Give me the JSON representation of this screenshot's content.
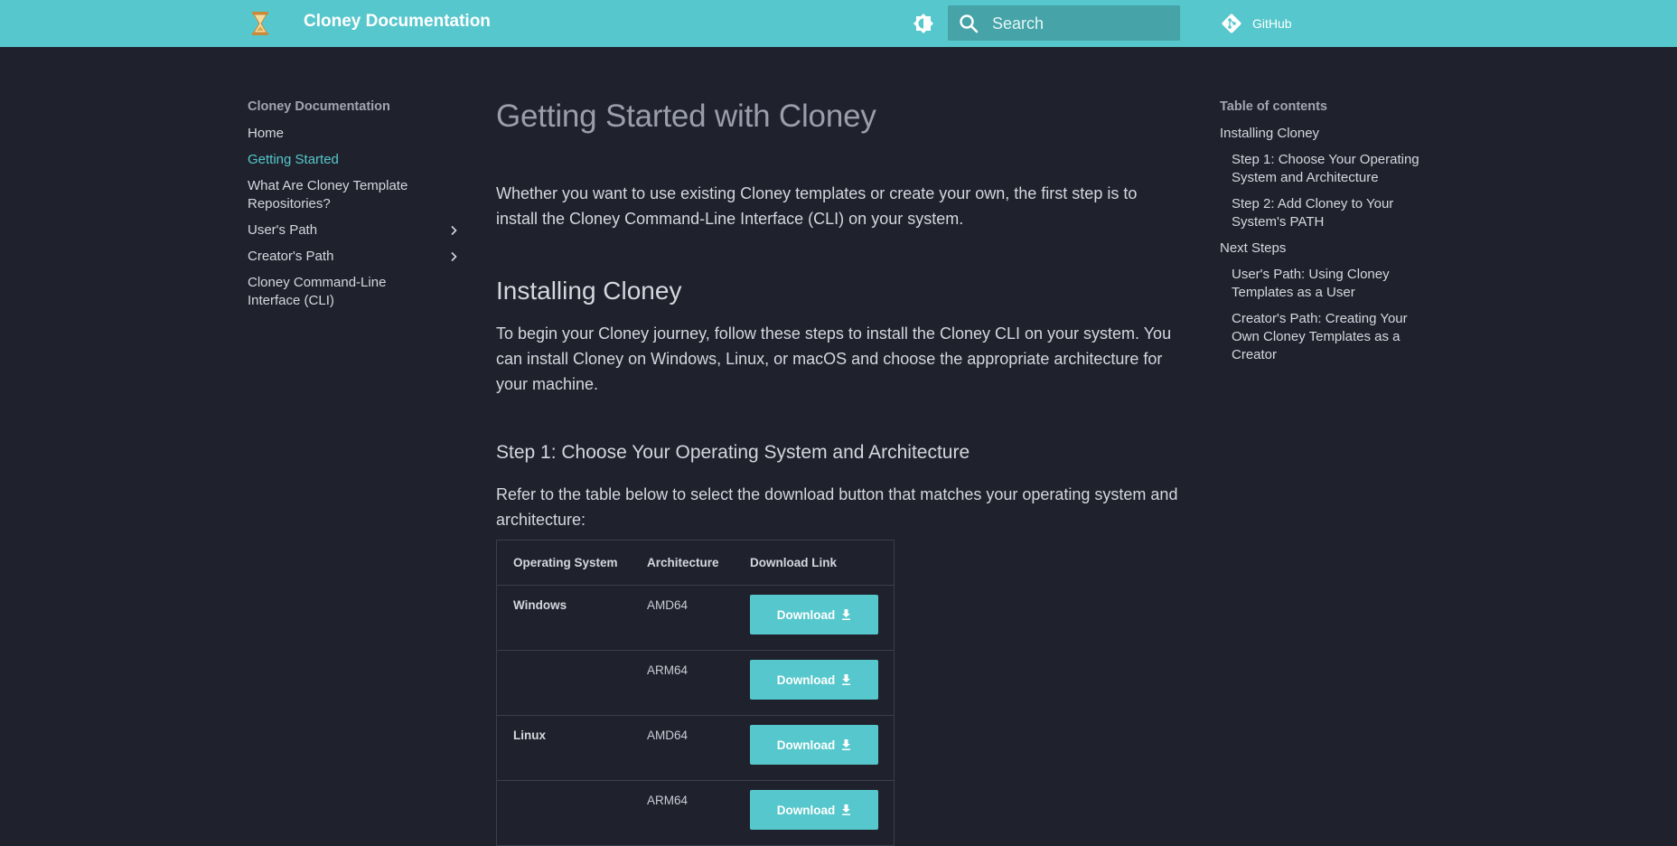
{
  "header": {
    "site_title": "Cloney Documentation",
    "search_placeholder": "Search",
    "repo_label": "GitHub"
  },
  "nav": {
    "title": "Cloney Documentation",
    "items": [
      {
        "label": "Home"
      },
      {
        "label": "Getting Started",
        "active": true
      },
      {
        "label": "What Are Cloney Template Repositories?"
      },
      {
        "label": "User's Path",
        "expandable": true
      },
      {
        "label": "Creator's Path",
        "expandable": true
      },
      {
        "label": "Cloney Command-Line Interface (CLI)"
      }
    ]
  },
  "main": {
    "title": "Getting Started with Cloney",
    "intro": "Whether you want to use existing Cloney templates or create your own, the first step is to install the Cloney Command-Line Interface (CLI) on your system.",
    "section_installing": {
      "heading": "Installing Cloney",
      "text": "To begin your Cloney journey, follow these steps to install the Cloney CLI on your system. You can install Cloney on Windows, Linux, or macOS and choose the appropriate architecture for your machine."
    },
    "step1": {
      "heading": "Step 1: Choose Your Operating System and Architecture",
      "text": "Refer to the table below to select the download button that matches your operating system and architecture:"
    },
    "table": {
      "headers": [
        "Operating System",
        "Architecture",
        "Download Link"
      ],
      "rows": [
        {
          "os": "Windows",
          "arch": "AMD64",
          "button": "Download"
        },
        {
          "os": "",
          "arch": "ARM64",
          "button": "Download"
        },
        {
          "os": "Linux",
          "arch": "AMD64",
          "button": "Download"
        },
        {
          "os": "",
          "arch": "ARM64",
          "button": "Download"
        }
      ]
    }
  },
  "toc": {
    "title": "Table of contents",
    "items": [
      {
        "label": "Installing Cloney",
        "level": 1
      },
      {
        "label": "Step 1: Choose Your Operating System and Architecture",
        "level": 2
      },
      {
        "label": "Step 2: Add Cloney to Your System's PATH",
        "level": 2
      },
      {
        "label": "Next Steps",
        "level": 1
      },
      {
        "label": "User's Path: Using Cloney Templates as a User",
        "level": 2
      },
      {
        "label": "Creator's Path: Creating Your Own Cloney Templates as a Creator",
        "level": 2
      }
    ]
  },
  "colors": {
    "primary": "#56c7cc",
    "background": "#1f222c",
    "text": "#d5d7de",
    "muted": "#9a9eab"
  },
  "icons": [
    "hourglass-icon",
    "brightness-icon",
    "search-icon",
    "git-icon",
    "chevron-right-icon",
    "download-icon"
  ]
}
